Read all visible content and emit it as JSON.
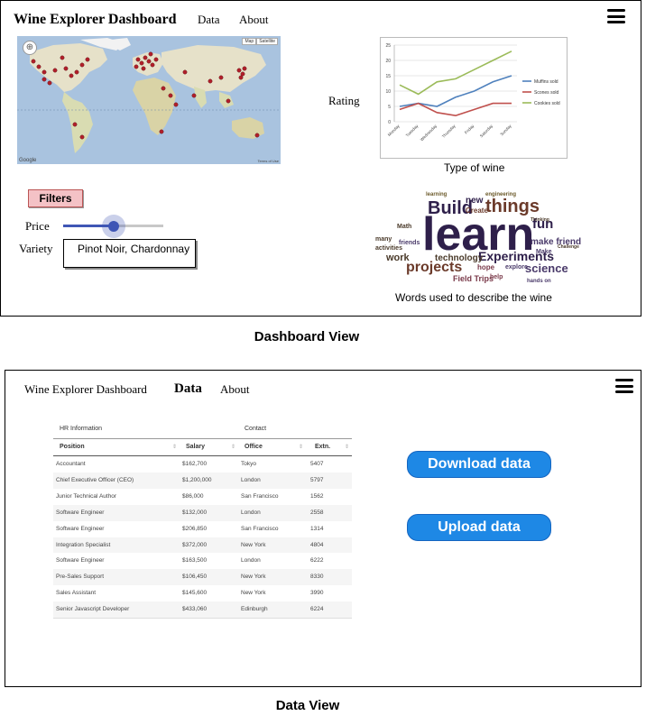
{
  "dashboard_view": {
    "app_title": "Wine Explorer Dashboard",
    "nav": [
      {
        "label": "Data"
      },
      {
        "label": "About"
      }
    ],
    "map": {
      "type_buttons": [
        "Map",
        "Satellite"
      ],
      "attribution": "Google",
      "footer": "Terms of Use"
    },
    "filters": {
      "button_label": "Filters",
      "price_label": "Price",
      "price_value_fraction": 0.5,
      "variety_label": "Variety",
      "variety_value": "Pinot Noir, Chardonnay"
    },
    "rating_chart": {
      "side_label": "Rating",
      "xlabel": "Type of wine"
    },
    "word_cloud": {
      "caption": "Words used to describe the wine",
      "words": [
        {
          "text": "learn",
          "size": 52,
          "color": "#2e1f4a"
        },
        {
          "text": "Build",
          "size": 20,
          "color": "#2e1f4a"
        },
        {
          "text": "things",
          "size": 20,
          "color": "#6b3a2a"
        },
        {
          "text": "projects",
          "size": 16,
          "color": "#6b3a2a"
        },
        {
          "text": "Experiments",
          "size": 14,
          "color": "#2e1f4a"
        },
        {
          "text": "fun",
          "size": 15,
          "color": "#2e1f4a"
        },
        {
          "text": "science",
          "size": 13,
          "color": "#4a3a6a"
        },
        {
          "text": "technology",
          "size": 10,
          "color": "#4a3a2a"
        },
        {
          "text": "work",
          "size": 11,
          "color": "#4a3a2a"
        },
        {
          "text": "make friends",
          "size": 10,
          "color": "#4a3a6a"
        },
        {
          "text": "new",
          "size": 10,
          "color": "#2e1f4a"
        },
        {
          "text": "Create",
          "size": 8,
          "color": "#6b3a2a"
        },
        {
          "text": "Field Trips",
          "size": 9,
          "color": "#7a3a4a"
        },
        {
          "text": "hope",
          "size": 8,
          "color": "#7a3a4a"
        },
        {
          "text": "explore",
          "size": 7,
          "color": "#4a3a6a"
        },
        {
          "text": "friends",
          "size": 7,
          "color": "#4a3a6a"
        },
        {
          "text": "activities",
          "size": 7,
          "color": "#4a3a2a"
        },
        {
          "text": "Make",
          "size": 7,
          "color": "#4a3a6a"
        },
        {
          "text": "many",
          "size": 7,
          "color": "#4a3a2a"
        },
        {
          "text": "Math",
          "size": 7,
          "color": "#4a3a2a"
        },
        {
          "text": "help",
          "size": 7,
          "color": "#7a3a4a"
        },
        {
          "text": "hands on",
          "size": 6,
          "color": "#4a3a6a"
        },
        {
          "text": "learning",
          "size": 6,
          "color": "#6b5a2a"
        },
        {
          "text": "engineering",
          "size": 6,
          "color": "#6b5a2a"
        },
        {
          "text": "Thinking",
          "size": 5,
          "color": "#4a3a2a"
        },
        {
          "text": "Challenge",
          "size": 5,
          "color": "#4a3a2a"
        }
      ]
    },
    "caption": "Dashboard View"
  },
  "data_view": {
    "app_title": "Wine Explorer Dashboard",
    "nav": [
      {
        "label": "Data"
      },
      {
        "label": "About"
      }
    ],
    "table": {
      "group_headers": {
        "hr": "HR Information",
        "contact": "Contact"
      },
      "columns": [
        "Position",
        "Salary",
        "Office",
        "Extn."
      ],
      "rows": [
        [
          "Accountant",
          "$162,700",
          "Tokyo",
          "5407"
        ],
        [
          "Chief Executive Officer (CEO)",
          "$1,200,000",
          "London",
          "5797"
        ],
        [
          "Junior Technical Author",
          "$86,000",
          "San Francisco",
          "1562"
        ],
        [
          "Software Engineer",
          "$132,000",
          "London",
          "2558"
        ],
        [
          "Software Engineer",
          "$206,850",
          "San Francisco",
          "1314"
        ],
        [
          "Integration Specialist",
          "$372,000",
          "New York",
          "4804"
        ],
        [
          "Software Engineer",
          "$163,500",
          "London",
          "6222"
        ],
        [
          "Pre-Sales Support",
          "$106,450",
          "New York",
          "8330"
        ],
        [
          "Sales Assistant",
          "$145,600",
          "New York",
          "3990"
        ],
        [
          "Senior Javascript Developer",
          "$433,060",
          "Edinburgh",
          "6224"
        ]
      ]
    },
    "buttons": {
      "download": "Download data",
      "upload": "Upload data"
    },
    "caption": "Data View"
  },
  "chart_data": {
    "type": "line",
    "categories": [
      "Monday",
      "Tuesday",
      "Wednesday",
      "Thursday",
      "Friday",
      "Saturday",
      "Sunday"
    ],
    "series": [
      {
        "name": "Muffins sold",
        "color": "#4f81bd",
        "values": [
          5,
          6,
          5,
          8,
          10,
          13,
          15
        ]
      },
      {
        "name": "Scones sold",
        "color": "#c0504d",
        "values": [
          4,
          6,
          3,
          2,
          4,
          6,
          6
        ]
      },
      {
        "name": "Cookies sold",
        "color": "#9bbb59",
        "values": [
          12,
          9,
          13,
          14,
          17,
          20,
          23
        ]
      }
    ],
    "y_ticks": [
      "0",
      "5",
      "10",
      "15",
      "20",
      "25"
    ],
    "ylim": [
      0,
      25
    ],
    "grid": true,
    "legend": "right"
  },
  "colors": {
    "accent_button": "#1e88e5",
    "slider": "#3f56b5",
    "filters_button": "#f4c2c6"
  },
  "icons": {
    "menu": "hamburger-menu-icon",
    "map_pin": "map-pin-icon",
    "sort": "sort-icon",
    "locate": "locate-icon"
  }
}
